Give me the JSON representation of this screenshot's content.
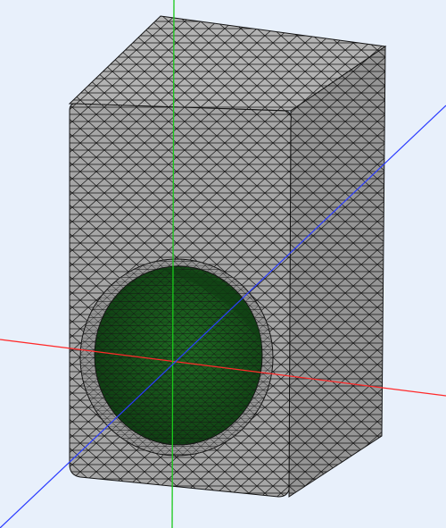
{
  "viewport": {
    "background": "#e8f0fb",
    "mesh_edge_color": "#141414"
  },
  "model": {
    "block_faces": {
      "front": "#a6a6a6",
      "side": "#959595",
      "top": "#b2b2b2"
    },
    "cavity_color": "#1f6b22",
    "cavity_shadow_color": "#0f3d12"
  },
  "axes": {
    "x_color": "#ff2a2a",
    "y_color": "#1ac81a",
    "z_color": "#2b3cff"
  }
}
